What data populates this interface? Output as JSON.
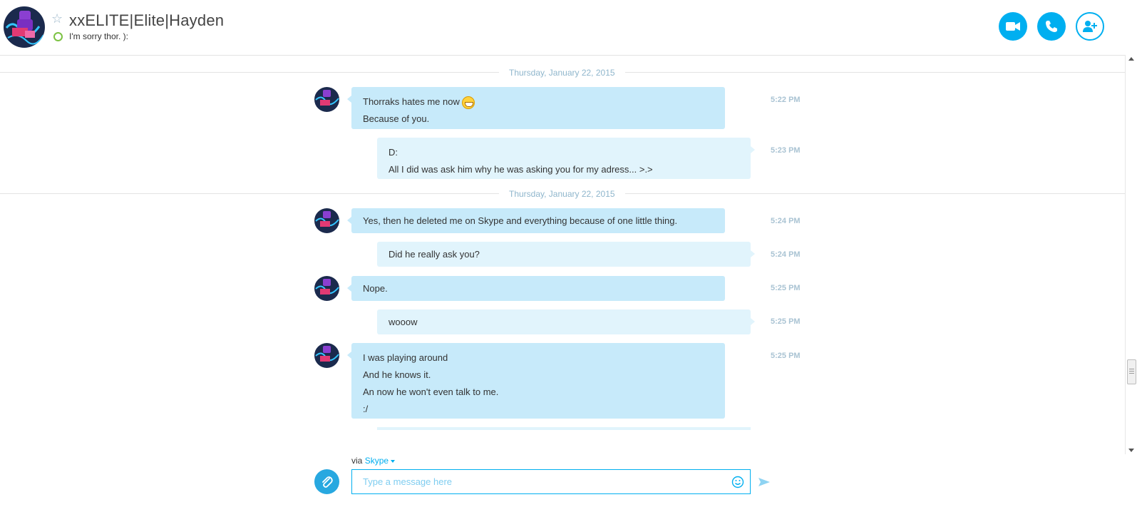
{
  "header": {
    "contact_name": "xxELITE|Elite|Hayden",
    "mood": "I'm sorry thor. ):"
  },
  "conversation": {
    "date_separators": [
      "Thursday, January 22, 2015",
      "Thursday, January 22, 2015"
    ],
    "messages": [
      {
        "direction": "in",
        "time": "5:22 PM",
        "lines": [
          "Thorraks hates me now",
          "Because of you."
        ],
        "emoticon": "grin"
      },
      {
        "direction": "out",
        "time": "5:23 PM",
        "lines": [
          "D:",
          "All I did was ask him why he was asking you for my adress... >.>"
        ]
      },
      {
        "direction": "in",
        "time": "5:24 PM",
        "lines": [
          "Yes, then he deleted me on Skype and everything because of one little thing."
        ]
      },
      {
        "direction": "out",
        "time": "5:24 PM",
        "lines": [
          "Did he really ask you?"
        ]
      },
      {
        "direction": "in",
        "time": "5:25 PM",
        "lines": [
          "Nope."
        ]
      },
      {
        "direction": "out",
        "time": "5:25 PM",
        "lines": [
          "wooow"
        ]
      },
      {
        "direction": "in",
        "time": "5:25 PM",
        "lines": [
          "I was playing around",
          "And he knows it.",
          "An now he won't even talk to me.",
          ":/"
        ]
      }
    ]
  },
  "composer": {
    "via_prefix": "via",
    "via_service": "Skype",
    "placeholder": "Type a message here",
    "value": ""
  },
  "colors": {
    "accent": "#00aff0",
    "incoming_bubble": "#c7eafa",
    "outgoing_bubble": "#e1f4fc",
    "status_online": "#7cc243"
  },
  "icons": [
    "star-icon",
    "video-call-icon",
    "audio-call-icon",
    "add-contact-icon",
    "attach-icon",
    "emoticon-icon",
    "send-icon"
  ]
}
